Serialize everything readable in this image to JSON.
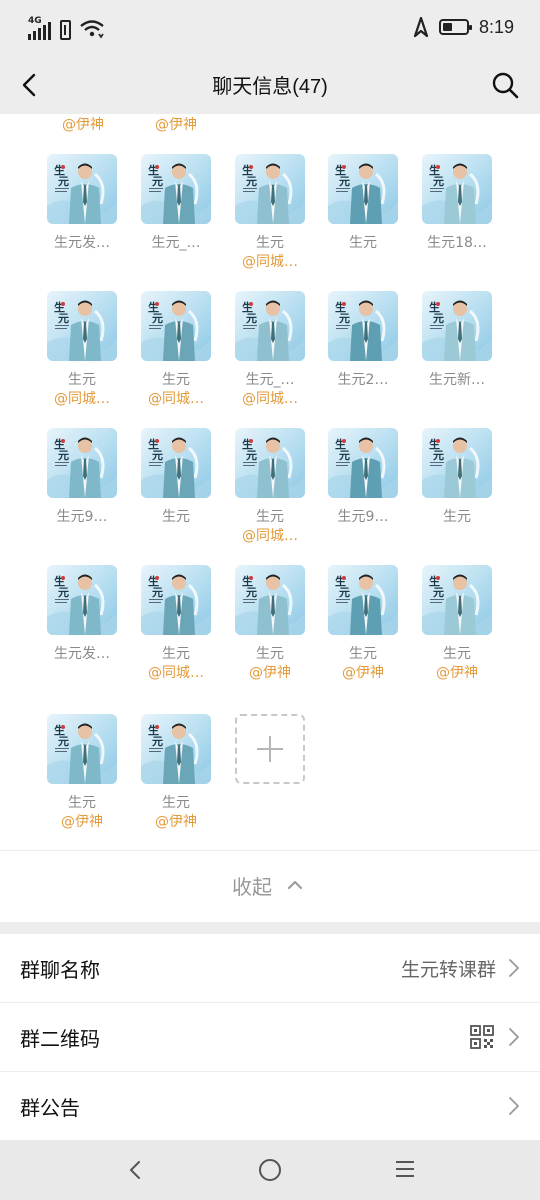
{
  "status_bar": {
    "network": "4G",
    "time": "8:19"
  },
  "header": {
    "title": "聊天信息(47)"
  },
  "top_partial_tags": [
    "@伊神",
    "@伊神"
  ],
  "members": [
    {
      "name": "生元发…",
      "tag": ""
    },
    {
      "name": "生元_…",
      "tag": ""
    },
    {
      "name": "生元",
      "tag": "@同城…"
    },
    {
      "name": "生元",
      "tag": ""
    },
    {
      "name": "生元18…",
      "tag": ""
    },
    {
      "name": "生元",
      "tag": "@同城…"
    },
    {
      "name": "生元",
      "tag": "@同城…"
    },
    {
      "name": "生元_…",
      "tag": "@同城…"
    },
    {
      "name": "生元2…",
      "tag": ""
    },
    {
      "name": "生元新…",
      "tag": ""
    },
    {
      "name": "生元9…",
      "tag": ""
    },
    {
      "name": "生元",
      "tag": ""
    },
    {
      "name": "生元",
      "tag": "@同城…"
    },
    {
      "name": "生元9…",
      "tag": ""
    },
    {
      "name": "生元",
      "tag": ""
    },
    {
      "name": "生元发…",
      "tag": ""
    },
    {
      "name": "生元",
      "tag": "@同城…"
    },
    {
      "name": "生元",
      "tag": "@伊神"
    },
    {
      "name": "生元",
      "tag": "@伊神"
    },
    {
      "name": "生元",
      "tag": "@伊神"
    },
    {
      "name": "生元",
      "tag": "@伊神"
    },
    {
      "name": "生元",
      "tag": "@伊神"
    }
  ],
  "collapse": {
    "label": "收起"
  },
  "settings": {
    "group_name_label": "群聊名称",
    "group_name_value": "生元转课群",
    "qr_code_label": "群二维码",
    "announcement_label": "群公告"
  },
  "colors": {
    "tag_orange": "#e39a3a",
    "name_gray": "#8a8a8a",
    "background": "#ededed"
  },
  "icons": {
    "back": "chevron-left-icon",
    "search": "search-icon",
    "add": "plus-icon",
    "collapse": "chevron-up-icon",
    "row_arrow": "chevron-right-icon",
    "qr": "qr-code-icon",
    "nav_back": "nav-back-icon",
    "nav_home": "nav-home-icon",
    "nav_menu": "nav-menu-icon"
  }
}
